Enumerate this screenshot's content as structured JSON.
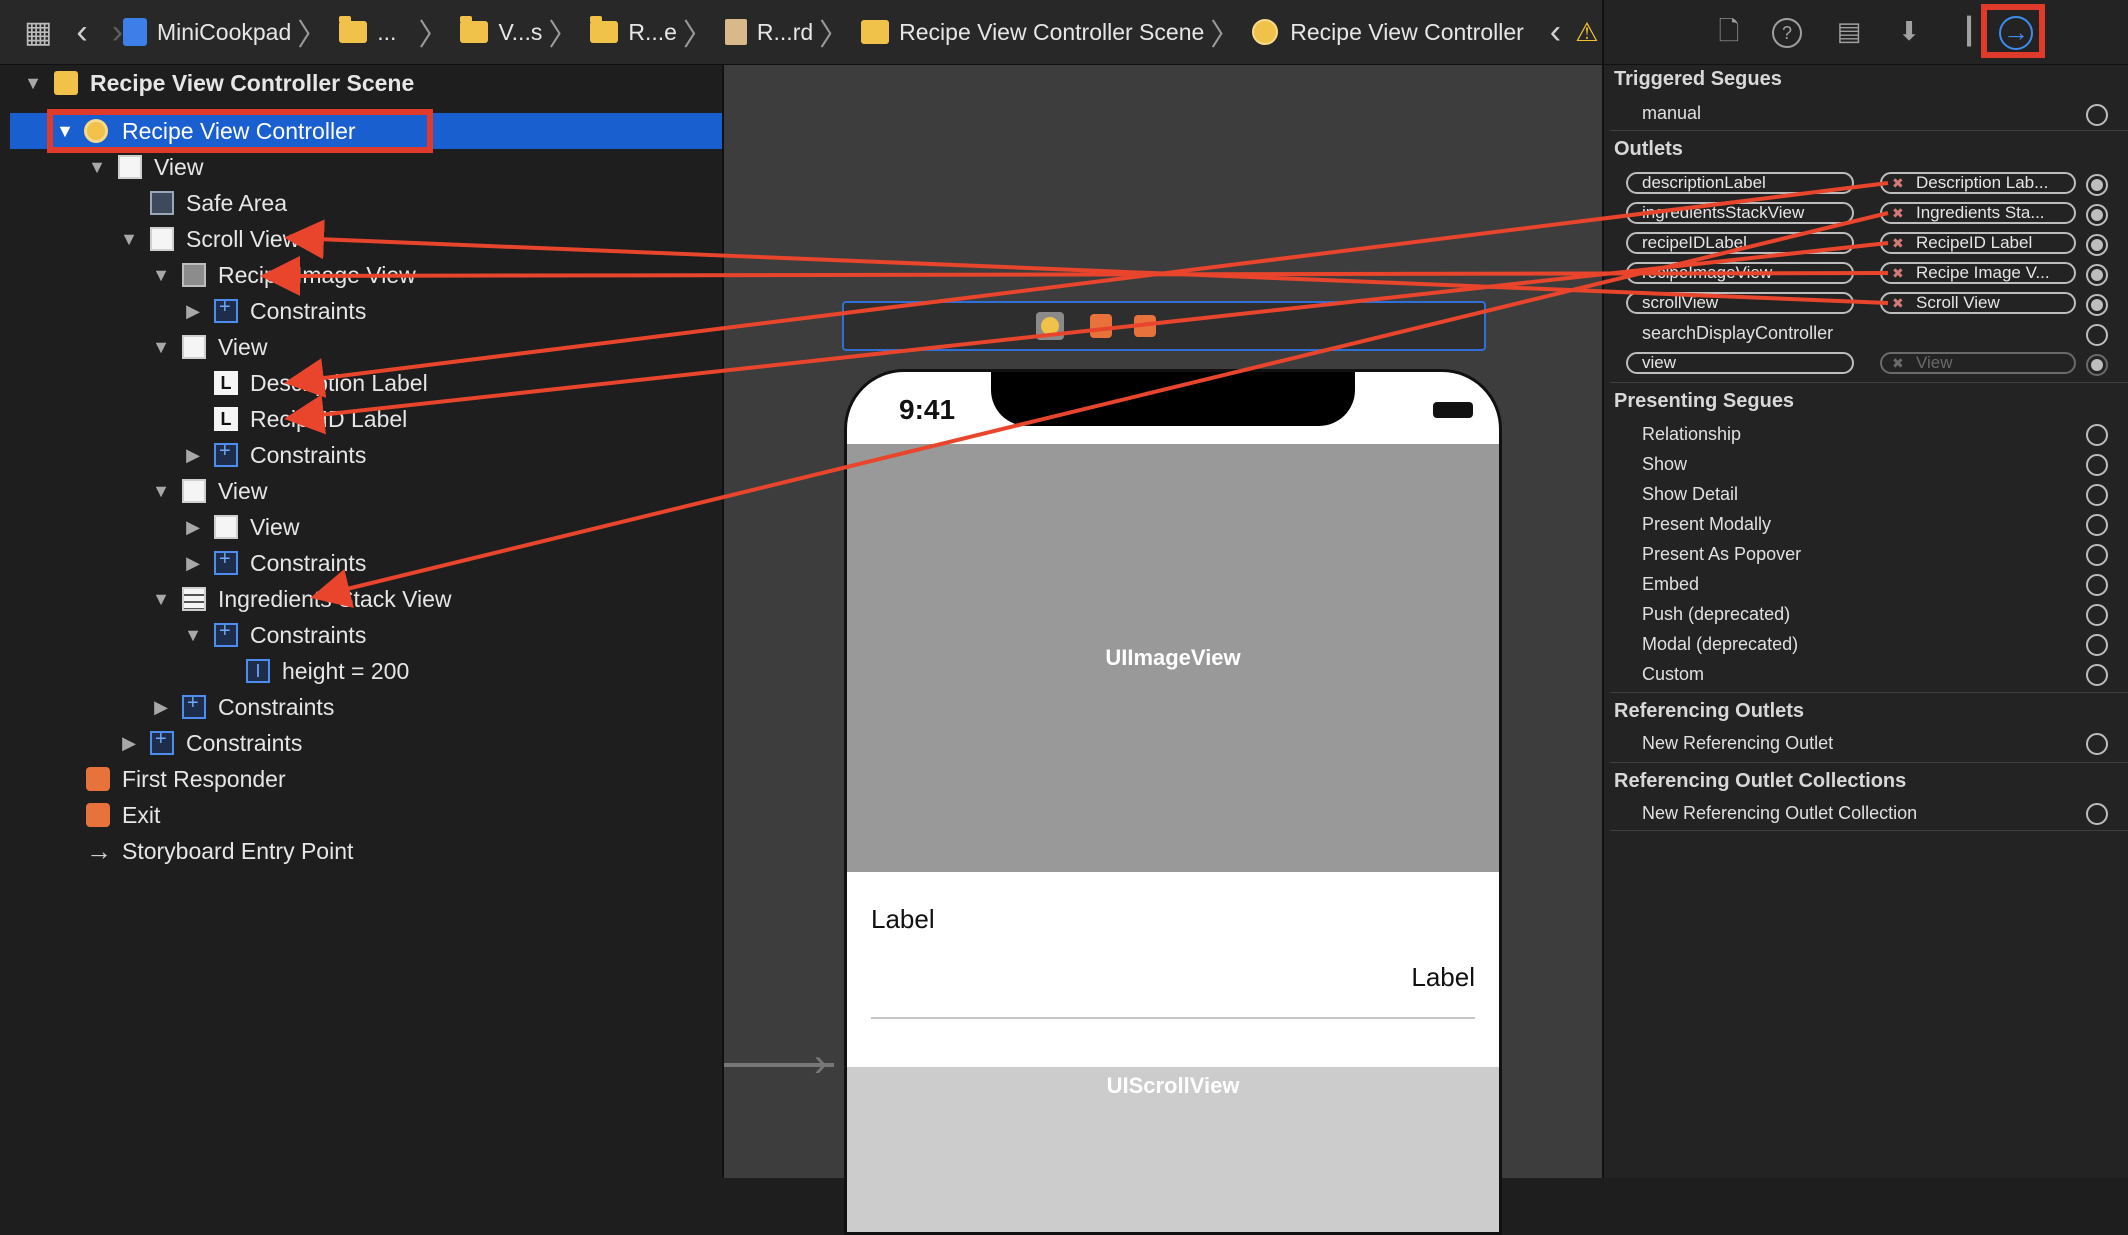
{
  "toolbar": {
    "breadcrumb": [
      {
        "label": "MiniCookpad",
        "icon": "project-icon"
      },
      {
        "label": "...",
        "icon": "folder-icon"
      },
      {
        "label": "V...s",
        "icon": "folder-icon"
      },
      {
        "label": "R...e",
        "icon": "folder-icon"
      },
      {
        "label": "R...rd",
        "icon": "storyboard-icon"
      },
      {
        "label": "Recipe View Controller Scene",
        "icon": "scene-icon"
      },
      {
        "label": "Recipe View Controller",
        "icon": "view-controller-icon"
      }
    ]
  },
  "outline": {
    "scene_title": "Recipe View Controller Scene",
    "rows": [
      {
        "label": "Recipe View Controller",
        "icon": "view-controller-icon",
        "selected": true
      },
      {
        "label": "View",
        "icon": "view-icon"
      },
      {
        "label": "Safe Area",
        "icon": "safe-area-icon"
      },
      {
        "label": "Scroll View",
        "icon": "view-icon"
      },
      {
        "label": "Recipe Image View",
        "icon": "image-view-icon"
      },
      {
        "label": "Constraints",
        "icon": "constraints-icon"
      },
      {
        "label": "View",
        "icon": "view-icon"
      },
      {
        "label": "Description Label",
        "icon": "label-icon"
      },
      {
        "label": "RecipeID Label",
        "icon": "label-icon"
      },
      {
        "label": "Constraints",
        "icon": "constraints-icon"
      },
      {
        "label": "View",
        "icon": "view-icon"
      },
      {
        "label": "View",
        "icon": "view-icon"
      },
      {
        "label": "Constraints",
        "icon": "constraints-icon"
      },
      {
        "label": "Ingredients Stack View",
        "icon": "stack-view-icon"
      },
      {
        "label": "Constraints",
        "icon": "constraints-icon"
      },
      {
        "label": "height = 200",
        "icon": "height-constraint-icon"
      },
      {
        "label": "Constraints",
        "icon": "constraints-icon"
      },
      {
        "label": "Constraints",
        "icon": "constraints-icon"
      },
      {
        "label": "First Responder",
        "icon": "first-responder-icon"
      },
      {
        "label": "Exit",
        "icon": "exit-icon"
      },
      {
        "label": "Storyboard Entry Point",
        "icon": "arrow-right-icon"
      }
    ]
  },
  "canvas": {
    "clock": "9:41",
    "image_view_label": "UIImageView",
    "label_1": "Label",
    "label_2": "Label",
    "scroll_view_label": "UIScrollView"
  },
  "inspector": {
    "triggered_segues": {
      "title": "Triggered Segues",
      "items": [
        "manual"
      ]
    },
    "outlets": {
      "title": "Outlets",
      "items": [
        {
          "name": "descriptionLabel",
          "target": "Description Lab..."
        },
        {
          "name": "ingredientsStackView",
          "target": "Ingredients Sta..."
        },
        {
          "name": "recipeIDLabel",
          "target": "RecipeID Label"
        },
        {
          "name": "recipeImageView",
          "target": "Recipe Image V..."
        },
        {
          "name": "scrollView",
          "target": "Scroll View"
        },
        {
          "name": "searchDisplayController",
          "target": ""
        },
        {
          "name": "view",
          "target": "View"
        }
      ]
    },
    "presenting_segues": {
      "title": "Presenting Segues",
      "items": [
        "Relationship",
        "Show",
        "Show Detail",
        "Present Modally",
        "Present As Popover",
        "Embed",
        "Push (deprecated)",
        "Modal (deprecated)",
        "Custom"
      ]
    },
    "referencing_outlets": {
      "title": "Referencing Outlets",
      "items": [
        "New Referencing Outlet"
      ]
    },
    "referencing_outlet_collections": {
      "title": "Referencing Outlet Collections",
      "items": [
        "New Referencing Outlet Collection"
      ]
    }
  },
  "colors": {
    "selection": "#1a5fd0",
    "highlight_box": "#e03a2b",
    "arrow": "#e8452c",
    "accent": "#3d8cf0"
  }
}
